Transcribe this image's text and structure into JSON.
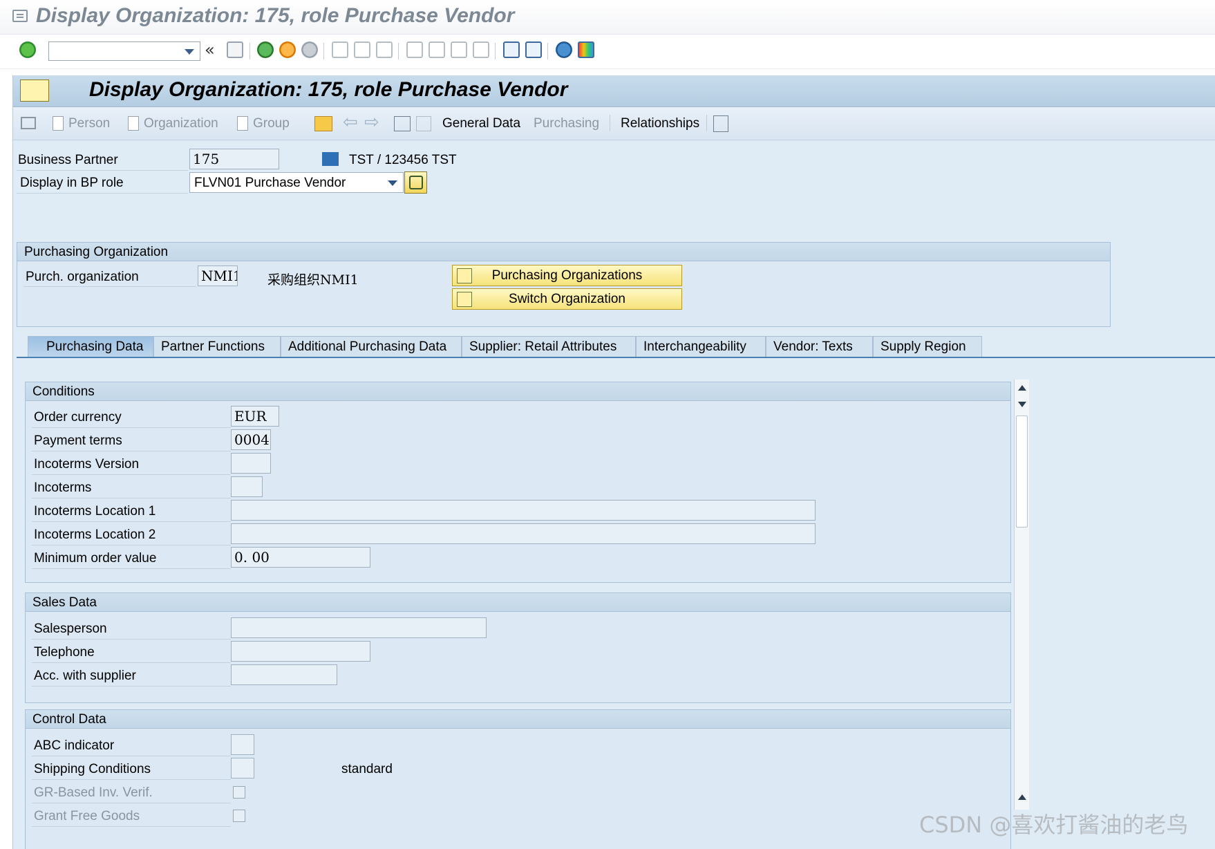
{
  "window": {
    "title": "Display Organization: 175, role Purchase Vendor"
  },
  "toolbar": {
    "command_field": "",
    "icons": [
      "enter-icon",
      "back-double-icon",
      "save-icon",
      "back-icon",
      "exit-icon",
      "cancel-icon",
      "print-icon",
      "find-icon",
      "find-next-icon",
      "first-page-icon",
      "previous-page-icon",
      "next-page-icon",
      "last-page-icon",
      "new-session-icon",
      "shortcut-icon",
      "help-icon",
      "customize-layout-icon"
    ]
  },
  "screen": {
    "title": "Display Organization: 175, role Purchase Vendor",
    "app_toolbar": {
      "person": "Person",
      "organization": "Organization",
      "group": "Group",
      "general_data": "General Data",
      "purchasing": "Purchasing",
      "relationships": "Relationships"
    }
  },
  "header": {
    "bp_label": "Business Partner",
    "bp_value": "175",
    "bp_description": "TST / 123456 TST",
    "role_label": "Display in BP role",
    "role_value": "FLVN01 Purchase Vendor"
  },
  "purch_org": {
    "group_title": "Purchasing Organization",
    "label": "Purch. organization",
    "value": "NMI1",
    "description": "采购组织NMI1",
    "btn_purch_orgs": "Purchasing Organizations",
    "btn_switch_org": "Switch Organization"
  },
  "tabs": [
    {
      "label": "Purchasing Data",
      "active": true
    },
    {
      "label": "Partner Functions",
      "active": false
    },
    {
      "label": "Additional Purchasing Data",
      "active": false
    },
    {
      "label": "Supplier: Retail Attributes",
      "active": false
    },
    {
      "label": "Interchangeability",
      "active": false
    },
    {
      "label": "Vendor: Texts",
      "active": false
    },
    {
      "label": "Supply Region",
      "active": false
    }
  ],
  "conditions": {
    "title": "Conditions",
    "order_currency_label": "Order currency",
    "order_currency": "EUR",
    "payment_terms_label": "Payment terms",
    "payment_terms": "0004",
    "incoterms_version_label": "Incoterms Version",
    "incoterms_version": "",
    "incoterms_label": "Incoterms",
    "incoterms": "",
    "incoterms_loc1_label": "Incoterms Location 1",
    "incoterms_loc1": "",
    "incoterms_loc2_label": "Incoterms Location 2",
    "incoterms_loc2": "",
    "min_order_label": "Minimum order value",
    "min_order": "0. 00"
  },
  "sales": {
    "title": "Sales Data",
    "salesperson_label": "Salesperson",
    "salesperson": "",
    "telephone_label": "Telephone",
    "telephone": "",
    "acc_label": "Acc. with supplier",
    "acc": ""
  },
  "control": {
    "title": "Control Data",
    "abc_label": "ABC indicator",
    "abc": "",
    "shipping_label": "Shipping Conditions",
    "shipping": "",
    "shipping_desc": "standard",
    "gr_label": "GR-Based Inv. Verif.",
    "gr_checked": false,
    "free_goods_label": "Grant Free Goods",
    "free_goods_checked": false
  },
  "watermark": "CSDN @喜欢打酱油的老鸟",
  "colors": {
    "panel_bg": "#dfebf5",
    "title_bar": "#b5cde2",
    "button_yellow": "#f6e27a"
  }
}
